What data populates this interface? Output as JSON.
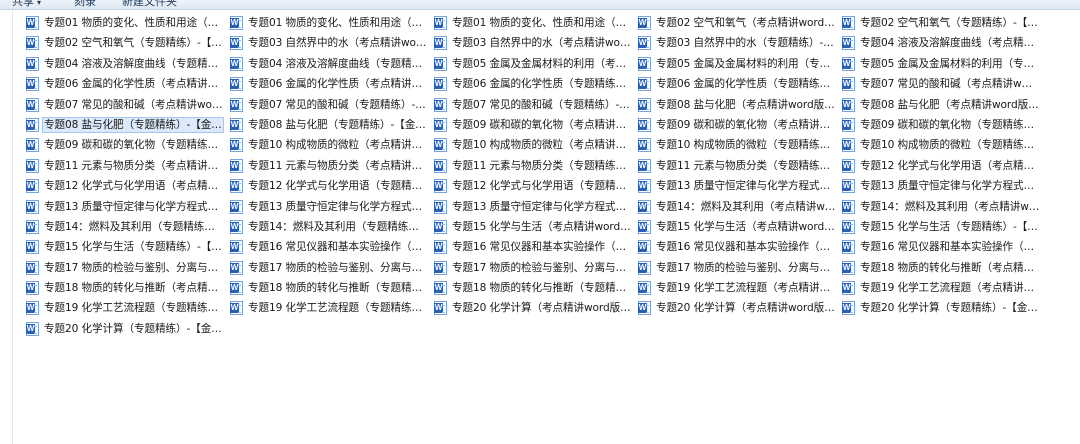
{
  "toolbar": {
    "share_label": "共享",
    "burn_label": "刻录",
    "new_folder_label": "新建文件夹"
  },
  "files": [
    "专题01 物质的变化、性质和用途（…",
    "专题01 物质的变化、性质和用途（…",
    "专题01 物质的变化、性质和用途（…",
    "专题02 空气和氧气（考点精讲word…",
    "专题02 空气和氧气（专题精练）-【…",
    "专题02 空气和氧气（专题精练）-【…",
    "专题03 自然界中的水（考点精讲wo…",
    "专题03 自然界中的水（考点精讲wo…",
    "专题03 自然界中的水（专题精练）-…",
    "专题04 溶液及溶解度曲线（考点精…",
    "专题04 溶液及溶解度曲线（专题精…",
    "专题04 溶液及溶解度曲线（专题精…",
    "专题05 金属及金属材料的利用（考…",
    "专题05 金属及金属材料的利用（专…",
    "专题05 金属及金属材料的利用（专…",
    "专题06 金属的化学性质（考点精讲…",
    "专题06 金属的化学性质（考点精讲…",
    "专题06 金属的化学性质（专题精练…",
    "专题06 金属的化学性质（专题精练…",
    "专题07 常见的酸和碱（考点精讲w…",
    "专题07 常见的酸和碱（考点精讲wo…",
    "专题07 常见的酸和碱（专题精练）-…",
    "专题07 常见的酸和碱（专题精练）-…",
    "专题08 盐与化肥（考点精讲word版…",
    "专题08 盐与化肥（考点精讲word版…",
    "专题08 盐与化肥（专题精练）-【金…",
    "专题08 盐与化肥（专题精练）-【金…",
    "专题09 碳和碳的氧化物（考点精讲…",
    "专题09 碳和碳的氧化物（考点精讲…",
    "专题09 碳和碳的氧化物（专题精练…",
    "专题09 碳和碳的氧化物（专题精练…",
    "专题10 构成物质的微粒（考点精讲…",
    "专题10 构成物质的微粒（考点精讲…",
    "专题10 构成物质的微粒（专题精练…",
    "专题10 构成物质的微粒（专题精练…",
    "专题11 元素与物质分类（考点精讲…",
    "专题11 元素与物质分类（考点精讲…",
    "专题11 元素与物质分类（专题精练…",
    "专题11 元素与物质分类（专题精练…",
    "专题12 化学式与化学用语（考点精…",
    "专题12 化学式与化学用语（考点精…",
    "专题12 化学式与化学用语（专题精…",
    "专题12 化学式与化学用语（专题精…",
    "专题13 质量守恒定律与化学方程式…",
    "专题13 质量守恒定律与化学方程式…",
    "专题13 质量守恒定律与化学方程式…",
    "专题13 质量守恒定律与化学方程式…",
    "专题13 质量守恒定律与化学方程式…",
    "专题14：燃料及其利用（考点精讲w…",
    "专题14：燃料及其利用（考点精讲w…",
    "专题14：燃料及其利用（专题精练…",
    "专题14：燃料及其利用（专题精练…",
    "专题15 化学与生活（考点精讲word…",
    "专题15 化学与生活（考点精讲word…",
    "专题15 化学与生活（专题精练）-【…",
    "专题15 化学与生活（专题精练）-【…",
    "专题16 常见仪器和基本实验操作（…",
    "专题16 常见仪器和基本实验操作（…",
    "专题16 常见仪器和基本实验操作（…",
    "专题16 常见仪器和基本实验操作（…",
    "专题17 物质的检验与鉴别、分离与…",
    "专题17 物质的检验与鉴别、分离与…",
    "专题17 物质的检验与鉴别、分离与…",
    "专题17 物质的检验与鉴别、分离与…",
    "专题18 物质的转化与推断（考点精…",
    "专题18 物质的转化与推断（考点精…",
    "专题18 物质的转化与推断（专题精…",
    "专题18 物质的转化与推断（专题精…",
    "专题19 化学工艺流程题（考点精讲…",
    "专题19 化学工艺流程题（考点精讲…",
    "专题19 化学工艺流程题（专题精练…",
    "专题19 化学工艺流程题（专题精练…",
    "专题20 化学计算（考点精讲word版…",
    "专题20 化学计算（考点精讲word版…",
    "专题20 化学计算（专题精练）-【金…",
    "专题20 化学计算（专题精练）-【金…"
  ]
}
